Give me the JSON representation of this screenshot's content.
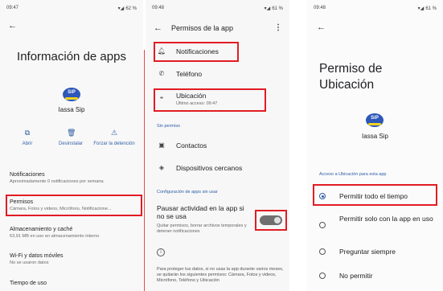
{
  "panel1": {
    "status": {
      "time": "09:47",
      "battery": "62 %"
    },
    "title": "Información de apps",
    "app_name": "Iassa Sip",
    "logo_text": "SiP",
    "actions": [
      {
        "label": "Abrir",
        "icon": "open-icon"
      },
      {
        "label": "Desinstalar",
        "icon": "trash-icon"
      },
      {
        "label": "Forzar la detención",
        "icon": "warning-icon"
      }
    ],
    "items": [
      {
        "title": "Notificaciones",
        "subtitle": "Aproximadamente 0 notificaciones por semana"
      },
      {
        "title": "Permisos",
        "subtitle": "Cámara, Fotos y videos, Micrófono, Notificacione..."
      },
      {
        "title": "Almacenamiento y caché",
        "subtitle": "63,91 MB en uso en almacenamiento interno"
      },
      {
        "title": "Wi-Fi y datos móviles",
        "subtitle": "No se usaron datos"
      },
      {
        "title": "Tiempo de uso",
        "subtitle": ""
      }
    ]
  },
  "panel2": {
    "status": {
      "time": "09:48",
      "battery": "61 %"
    },
    "title": "Permisos de la app",
    "allowed": [
      {
        "label": "Notificaciones",
        "icon": "bell-icon",
        "sub": ""
      },
      {
        "label": "Teléfono",
        "icon": "phone-icon",
        "sub": ""
      },
      {
        "label": "Ubicación",
        "icon": "location-icon",
        "sub": "Último acceso: 09:47"
      }
    ],
    "denied_section": "Sin permiso",
    "denied": [
      {
        "label": "Contactos",
        "icon": "contacts-icon"
      },
      {
        "label": "Dispositivos cercanos",
        "icon": "nearby-devices-icon"
      }
    ],
    "unused_section": "Configuración de apps sin usar",
    "pause_title": "Pausar actividad en la app si no se usa",
    "pause_desc": "Quitar permisos, borrar archivos temporales y detener notificaciones",
    "footer": "Para proteger tus datos, si no usas la app durante varios meses, se quitarán los siguientes permisos: Cámara, Fotos y videos, Micrófono, Teléfono y Ubicación"
  },
  "panel3": {
    "status": {
      "time": "09:48",
      "battery": "61 %"
    },
    "title": "Permiso de Ubicación",
    "app_name": "Iassa Sip",
    "logo_text": "SiP",
    "section": "Acceso a Ubicación para esta app",
    "options": [
      {
        "label": "Permitir todo el tiempo",
        "selected": true
      },
      {
        "label": "Permitir solo con la app en uso",
        "selected": false
      },
      {
        "label": "Preguntar siempre",
        "selected": false
      },
      {
        "label": "No permitir",
        "selected": false
      }
    ]
  },
  "colors": {
    "accent": "#2e5da6",
    "highlight": "#e21c23",
    "logo_blue": "#2d57b8",
    "logo_yellow": "#f4d21f"
  }
}
